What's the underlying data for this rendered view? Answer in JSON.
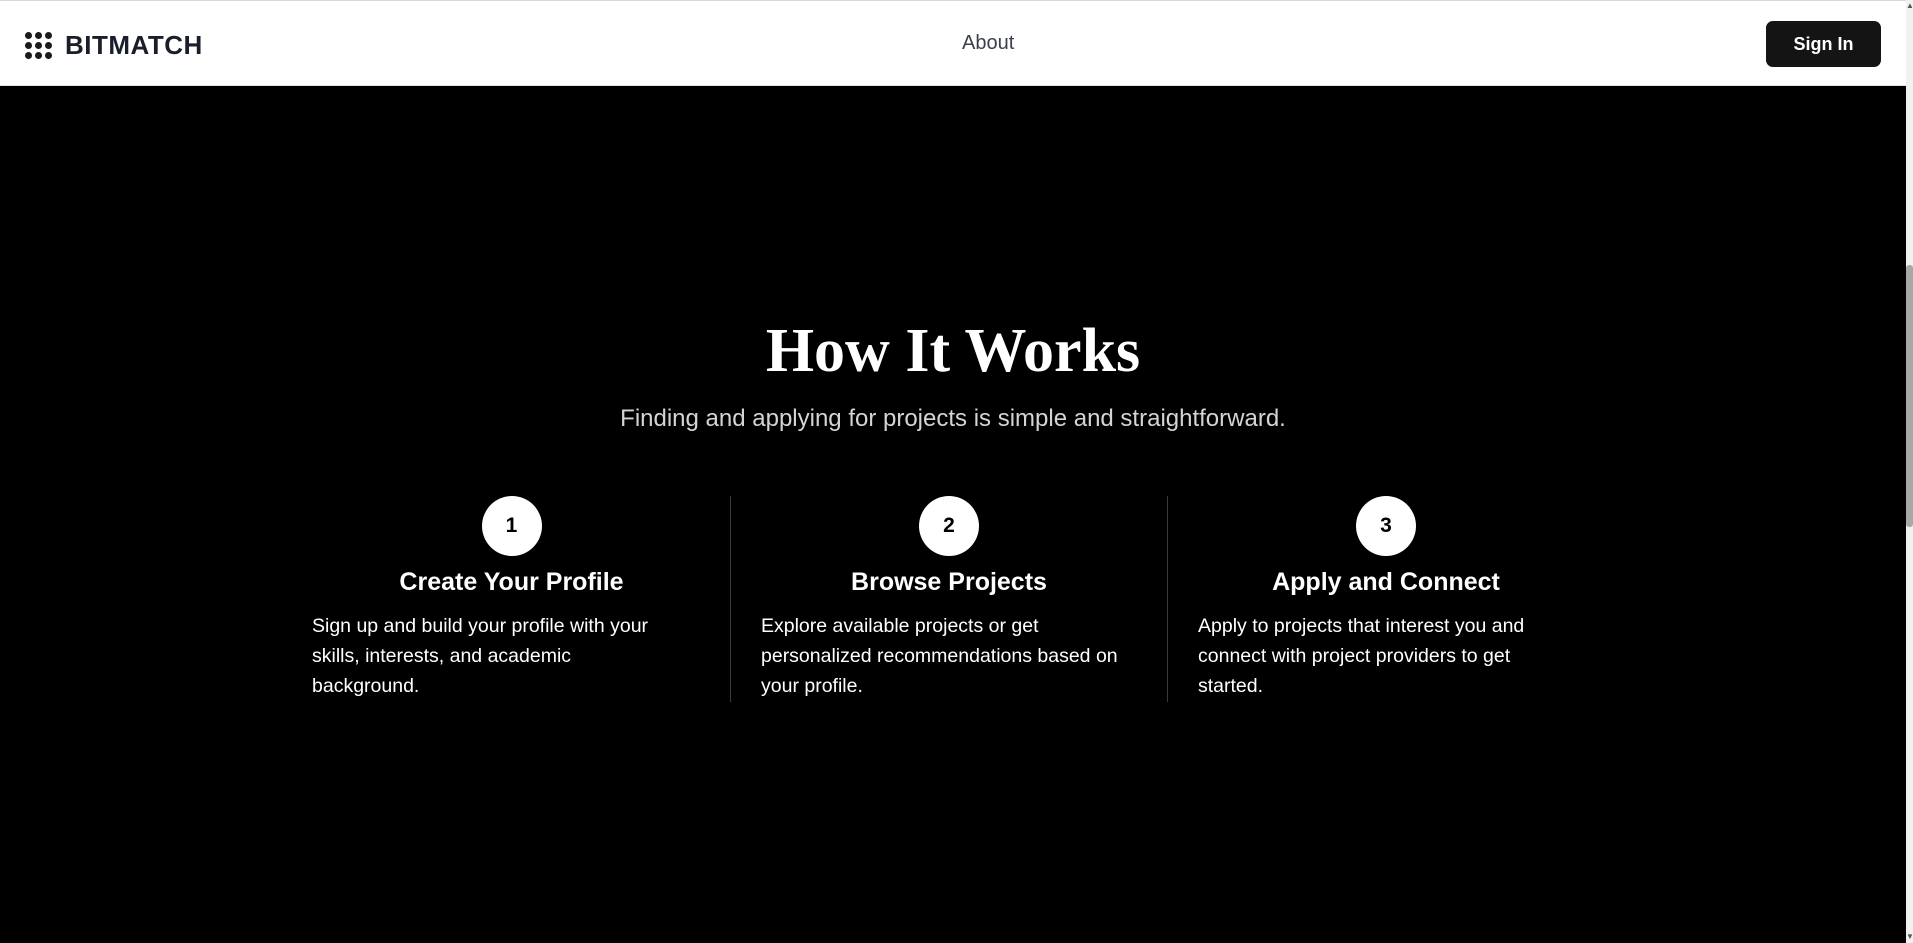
{
  "header": {
    "logo_text": "BITMATCH",
    "logo_icon": "dot-grid-icon",
    "nav_about": "About",
    "signin_label": "Sign In"
  },
  "how_it_works": {
    "title": "How It Works",
    "subtitle": "Finding and applying for projects is simple and straightforward.",
    "steps": [
      {
        "number": "1",
        "title": "Create Your Profile",
        "description": "Sign up and build your profile with your skills, interests, and academic background."
      },
      {
        "number": "2",
        "title": "Browse Projects",
        "description": "Explore available projects or get personalized recommendations based on your profile."
      },
      {
        "number": "3",
        "title": "Apply and Connect",
        "description": "Apply to projects that interest you and connect with project providers to get started."
      }
    ]
  },
  "scrollbar": {
    "up_icon": "arrow-up-icon",
    "down_icon": "arrow-down-icon"
  },
  "colors": {
    "page_bg": "#000000",
    "nav_bg": "#ffffff",
    "button_bg": "#141414",
    "text_light": "#ffffff",
    "subtitle": "#d4d4d4"
  }
}
